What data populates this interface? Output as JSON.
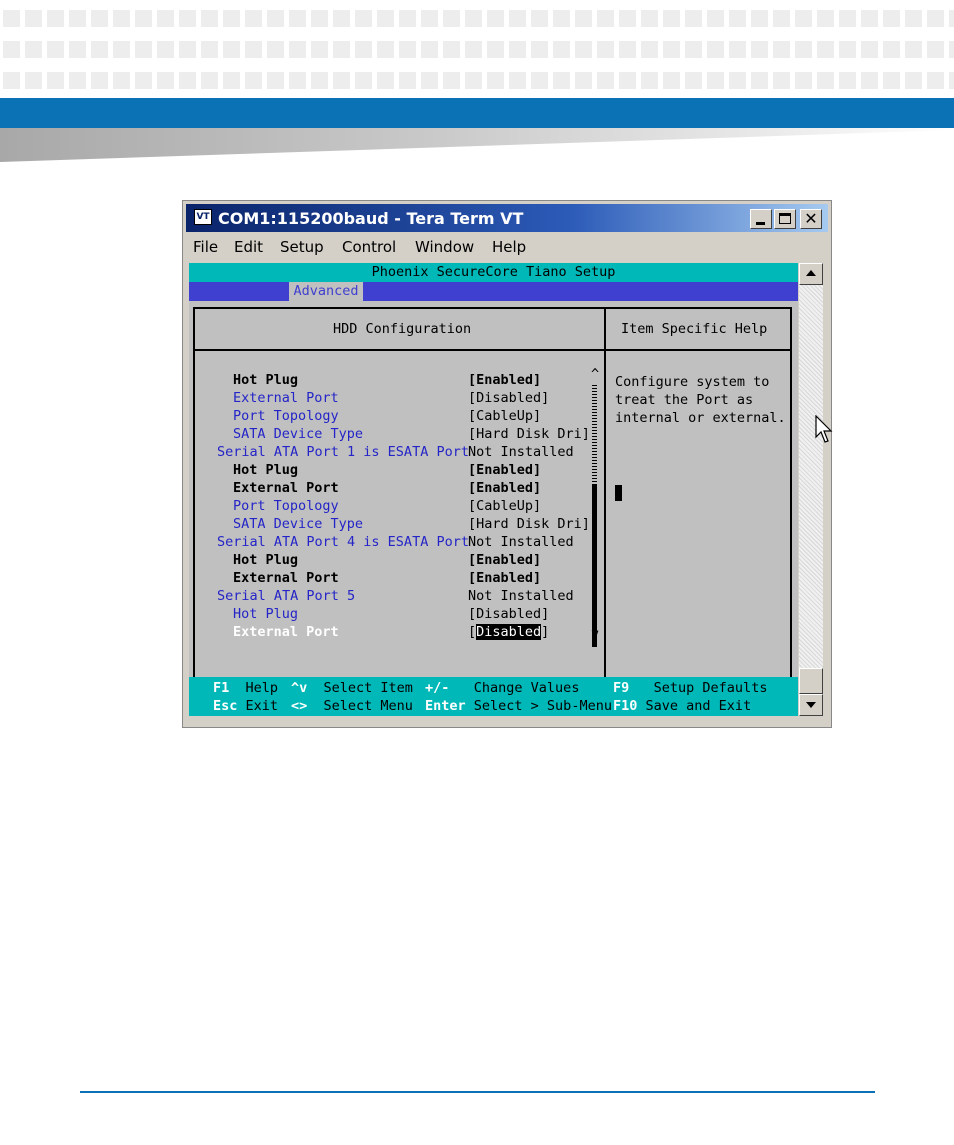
{
  "window": {
    "title": "COM1:115200baud - Tera Term VT",
    "icon": "VT"
  },
  "menu": [
    "File",
    "Edit",
    "Setup",
    "Control",
    "Window",
    "Help"
  ],
  "bios": {
    "title": "Phoenix SecureCore Tiano Setup",
    "active_tab": "Advanced",
    "panel_title": "HDD Configuration",
    "help_title": "Item Specific Help",
    "help_lines": [
      "Configure system to",
      "treat the Port as",
      "internal or external."
    ],
    "scroll_up_glyph": "^",
    "scroll_down_glyph": "v",
    "rows": [
      {
        "label": "Hot Plug",
        "value": "[Enabled]"
      },
      {
        "label": "External Port",
        "value": "[Disabled]"
      },
      {
        "label": "Port Topology",
        "value": "[CableUp]"
      },
      {
        "label": "SATA Device Type",
        "value": "[Hard Disk Dri]"
      },
      {
        "label": "Serial ATA Port 1 is ESATA Port",
        "value": "Not Installed"
      },
      {
        "label": "Hot Plug",
        "value": "[Enabled]"
      },
      {
        "label": "External Port",
        "value": "[Enabled]"
      },
      {
        "label": "Port Topology",
        "value": "[CableUp]"
      },
      {
        "label": "SATA Device Type",
        "value": "[Hard Disk Dri]"
      },
      {
        "label": "Serial ATA Port 4 is ESATA Port",
        "value": "Not Installed"
      },
      {
        "label": "Hot Plug",
        "value": "[Enabled]"
      },
      {
        "label": "External Port",
        "value": "[Enabled]"
      },
      {
        "label": "Serial ATA Port 5",
        "value": "Not Installed"
      },
      {
        "label": "Hot Plug",
        "value": "[Disabled]"
      },
      {
        "label": "External Port",
        "value": "Disabled",
        "value_open": "[",
        "value_close": "]"
      }
    ],
    "keys": [
      {
        "key": "F1",
        "desc": "Help"
      },
      {
        "key": "^v",
        "desc": "Select Item"
      },
      {
        "key": "+/-",
        "desc": "Change Values"
      },
      {
        "key": "F9",
        "desc": "Setup Defaults"
      },
      {
        "key": "Esc",
        "desc": "Exit"
      },
      {
        "key": "<>",
        "desc": "Select Menu"
      },
      {
        "key": "Enter",
        "desc": "Select > Sub-Menu"
      },
      {
        "key": "F10",
        "desc": "Save and Exit"
      }
    ]
  },
  "colors": {
    "brand_blue": "#0b72b5",
    "bios_cyan": "#00b8b8",
    "bios_blue": "#3f3fd0",
    "label_blue": "#2424c8"
  }
}
